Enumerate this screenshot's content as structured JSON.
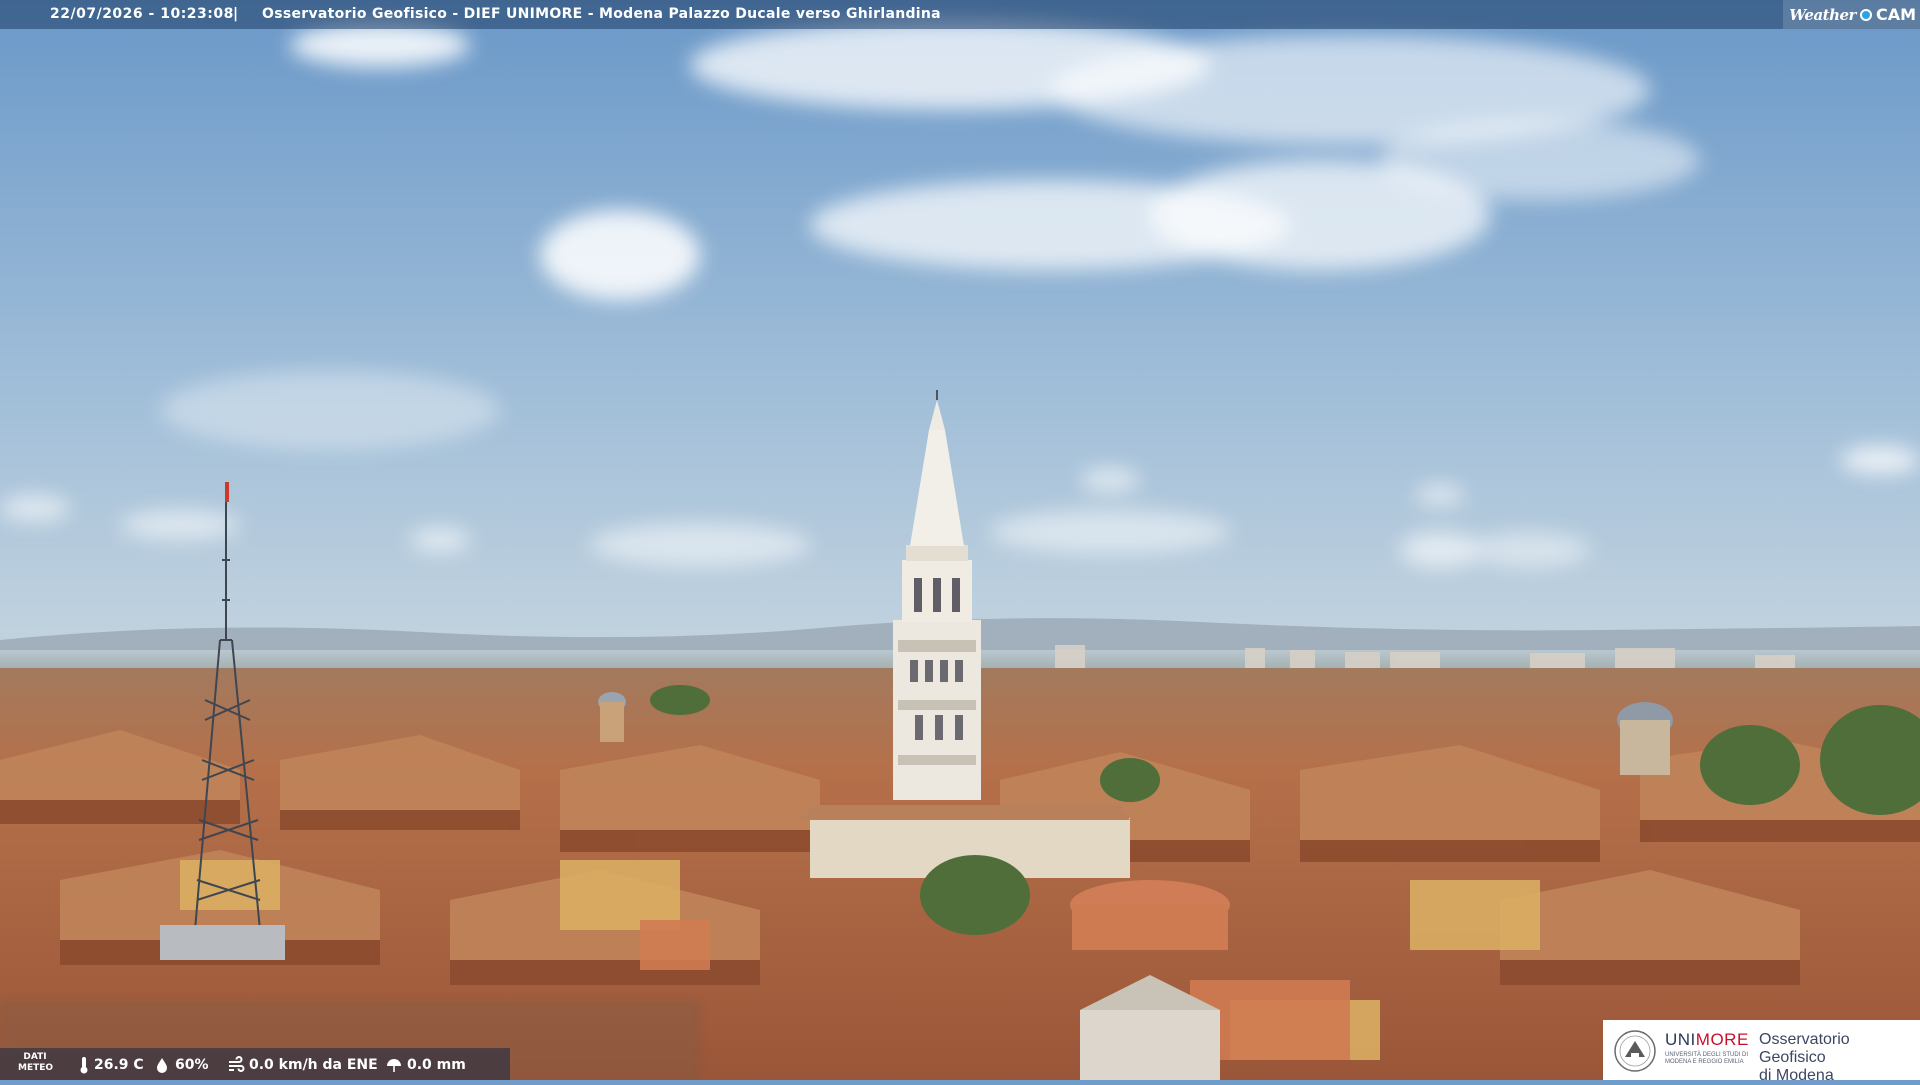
{
  "header": {
    "timestamp": "22/07/2026 - 10:23:08",
    "separator": "|",
    "title": "Osservatorio Geofisico - DIEF UNIMORE - Modena Palazzo Ducale verso Ghirlandina",
    "brand_left": "Weather",
    "brand_right": "CAM"
  },
  "weather": {
    "label_line1": "DATI",
    "label_line2": "METEO",
    "temperature": "26.9 C",
    "humidity": "60%",
    "wind": "0.0 km/h da ENE",
    "rain": "0.0 mm"
  },
  "logo": {
    "uni_a": "UNI",
    "uni_b": "MORE",
    "uni_sub": "UNIVERSITÀ DEGLI STUDI DI MODENA E REGGIO EMILIA",
    "observatory_line1": "Osservatorio Geofisico",
    "observatory_line2": "di Modena"
  },
  "colors": {
    "sky_top": "#6a98c8",
    "sky_horizon": "#b9cfe0",
    "roof": "#b0643c",
    "tower": "#efece6"
  },
  "icons": [
    "thermometer-icon",
    "humidity-drop-icon",
    "wind-icon",
    "rain-icon",
    "weathercam-dot-icon",
    "unimore-seal-icon"
  ]
}
